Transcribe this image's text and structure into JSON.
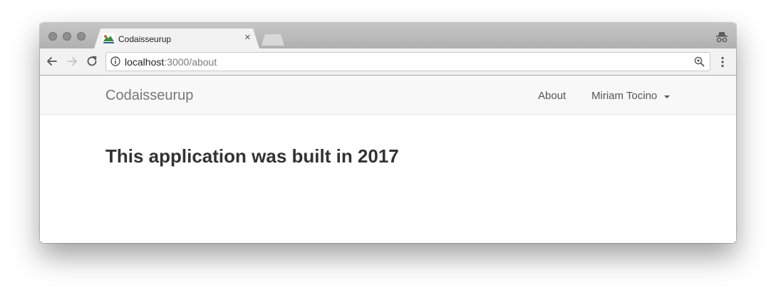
{
  "browser": {
    "tab": {
      "title": "Codaisseurup",
      "close_glyph": "×",
      "favicon": "app-favicon-icon"
    },
    "address_bar": {
      "host": "localhost",
      "path": ":3000/about"
    },
    "icons": [
      "back-arrow-icon",
      "forward-arrow-icon",
      "reload-icon",
      "info-icon",
      "zoom-icon",
      "menu-dots-icon",
      "incognito-icon"
    ]
  },
  "navbar": {
    "brand": "Codaisseurup",
    "links": {
      "about": "About",
      "user": "Miriam Tocino"
    }
  },
  "main": {
    "heading": "This application was built in 2017"
  }
}
